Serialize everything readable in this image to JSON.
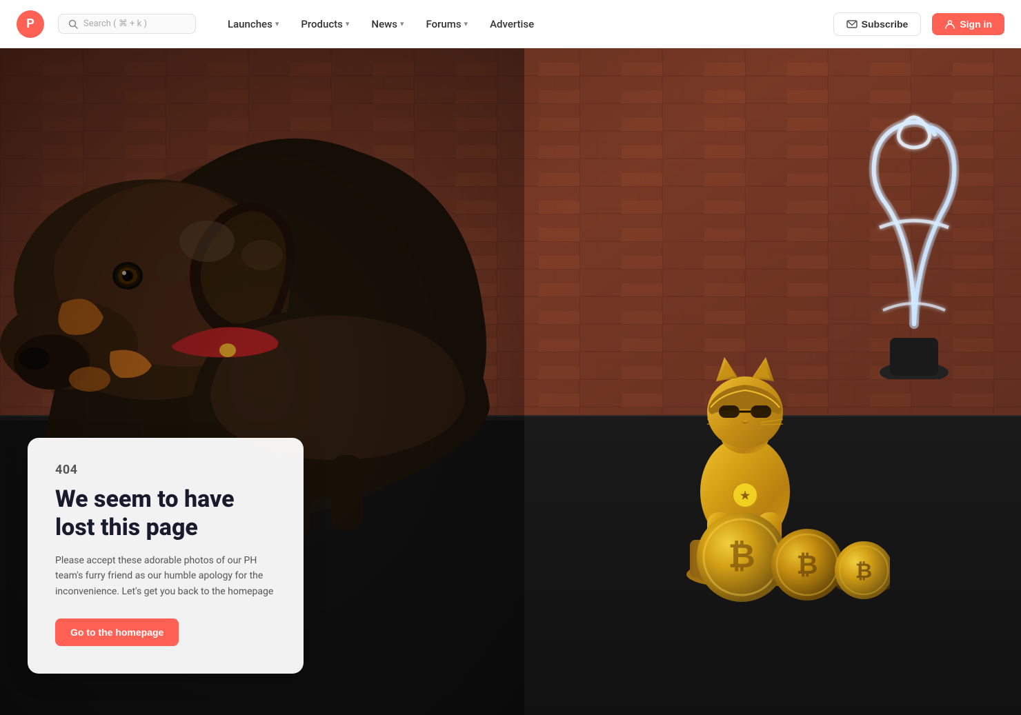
{
  "brand": {
    "logo_letter": "P",
    "logo_color": "#ff6154"
  },
  "navbar": {
    "search_placeholder": "Search ( ⌘ + k )",
    "items": [
      {
        "label": "Launches",
        "has_dropdown": true
      },
      {
        "label": "Products",
        "has_dropdown": true
      },
      {
        "label": "News",
        "has_dropdown": true
      },
      {
        "label": "Forums",
        "has_dropdown": true
      },
      {
        "label": "Advertise",
        "has_dropdown": false
      }
    ],
    "subscribe_label": "Subscribe",
    "signin_label": "Sign in"
  },
  "error_page": {
    "code": "404",
    "title": "We seem to have lost this page",
    "description": "Please accept these adorable photos of our PH team's furry friend as our humble apology for the inconvenience. Let's get you back to the homepage",
    "cta_label": "Go to the homepage"
  }
}
